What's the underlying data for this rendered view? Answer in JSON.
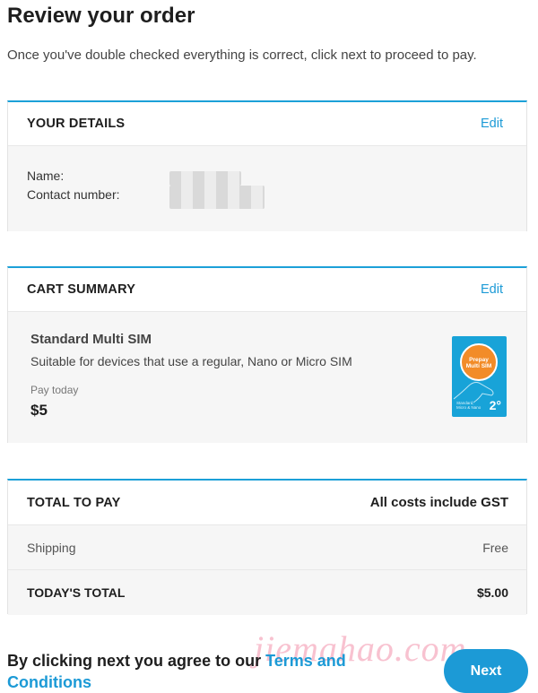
{
  "page": {
    "title": "Review your order",
    "subtitle": "Once you've double checked everything is correct, click next to proceed to pay."
  },
  "details": {
    "title": "YOUR DETAILS",
    "edit_label": "Edit",
    "name_label": "Name:",
    "contact_label": "Contact number:"
  },
  "cart": {
    "title": "CART SUMMARY",
    "edit_label": "Edit",
    "product_name": "Standard Multi SIM",
    "product_desc": "Suitable for devices that use a regular, Nano or Micro SIM",
    "pay_label": "Pay today",
    "price": "$5",
    "sim_image": {
      "badge_line1": "Prepay",
      "badge_line2": "Multi SIM",
      "small_text": "Standard, Micro & Nano",
      "logo": "2°"
    }
  },
  "total": {
    "title": "TOTAL TO PAY",
    "gst_note": "All costs include GST",
    "shipping_label": "Shipping",
    "shipping_value": "Free",
    "today_label": "TODAY'S TOTAL",
    "today_value": "$5.00"
  },
  "footer": {
    "agree_text": "By clicking next you agree to our ",
    "terms_label": "Terms and Conditions",
    "next_label": "Next"
  },
  "watermark": "jiemahao.com",
  "colors": {
    "accent": "#1c9ad6",
    "card_border_top": "#1ca0d8",
    "sim_badge": "#f28c28"
  }
}
